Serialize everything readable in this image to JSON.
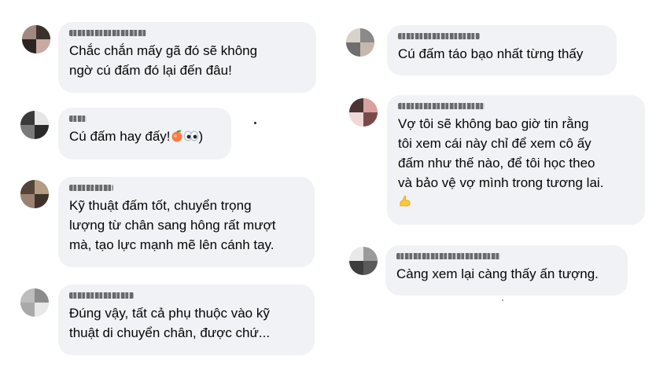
{
  "comments": [
    {
      "text": "Chắc chắn mấy gã đó sẽ không\nngờ cú đấm đó lại đến đâu!"
    },
    {
      "text": "Cú đấm hay đấy!",
      "suffix": ")"
    },
    {
      "text": "Kỹ thuật đấm tốt, chuyển trọng\nlượng từ chân sang hông rất mượt\nmà, tạo lực mạnh mẽ lên cánh tay."
    },
    {
      "text": "Đúng vậy, tất cả phụ thuộc vào kỹ\nthuật di chuyển chân, được chứ..."
    },
    {
      "text": "Cú đấm táo bạo nhất từng thấy"
    },
    {
      "text": "Vợ tôi sẽ không bao giờ tin rằng\ntôi xem cái này chỉ để xem cô ấy\nđấm như thế nào, để tôi học theo\nvà bảo vệ vợ mình trong tương lai."
    },
    {
      "text": "Càng xem lại càng thấy ấn tượng."
    }
  ],
  "icons": {
    "peach": "peach-emoji-icon",
    "eyes": "eyes-emoji-icon",
    "flex": "flexed-biceps-emoji-icon"
  },
  "colors": {
    "bubble": "#f0f2f5",
    "text": "#050505",
    "background": "#ffffff"
  }
}
